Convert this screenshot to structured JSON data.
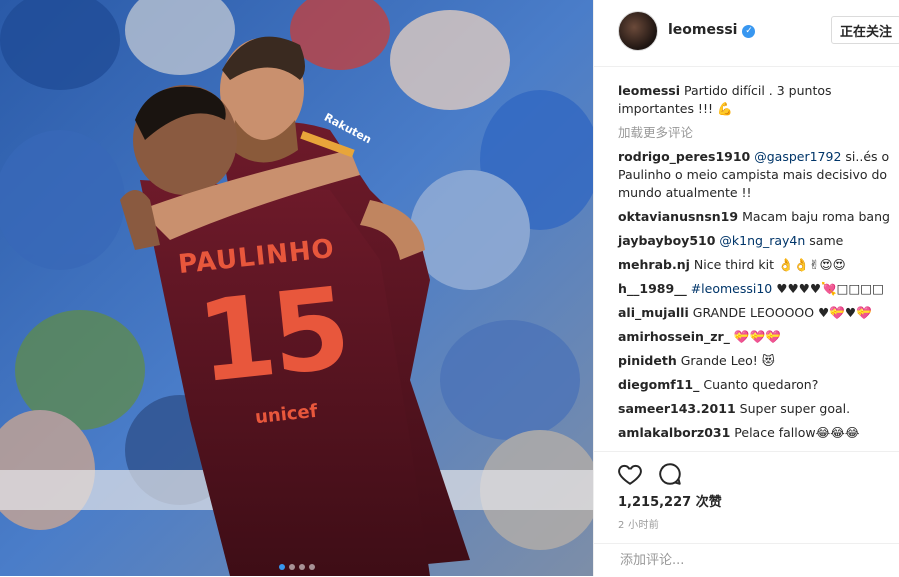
{
  "photo": {
    "jersey_name": "PAULINHO",
    "jersey_number": "15",
    "sponsor": "Rakuten",
    "brand": "unicef",
    "carousel": {
      "count": 4,
      "active": 0
    }
  },
  "header": {
    "username": "leomessi",
    "verified": true,
    "follow_label": "正在关注"
  },
  "caption": {
    "username": "leomessi",
    "text": "Partido difícil . 3 puntos importantes !!! 💪"
  },
  "load_more": "加载更多评论",
  "comments": [
    {
      "username": "rodrigo_peres1910",
      "mention": "@gasper1792",
      "text": "si..és o Paulinho o meio campista mais decisivo do mundo atualmente !!"
    },
    {
      "username": "oktavianusnsn19",
      "mention": "",
      "text": "Macam baju roma bang"
    },
    {
      "username": "jaybayboy510",
      "mention": "@k1ng_ray4n",
      "text": "same"
    },
    {
      "username": "mehrab.nj",
      "mention": "",
      "text": "Nice third kit 👌👌✌😍😍"
    },
    {
      "username": "h__1989__",
      "mention": "#leomessi10",
      "text": "♥♥♥♥💘□□□□"
    },
    {
      "username": "ali_mujalli",
      "mention": "",
      "text": "GRANDE LEOOOOO ♥💝♥💝"
    },
    {
      "username": "amirhossein_zr_",
      "mention": "",
      "text": "💝💝💝"
    },
    {
      "username": "pinideth",
      "mention": "",
      "text": "Grande Leo! 😻"
    },
    {
      "username": "diegomf11_",
      "mention": "",
      "text": "Cuanto quedaron?"
    },
    {
      "username": "sameer143.2011",
      "mention": "",
      "text": "Super super goal."
    },
    {
      "username": "amlakalborz031",
      "mention": "",
      "text": "Pelace fallow😂😂😂"
    }
  ],
  "actions": {
    "like_icon": "heart-icon",
    "comment_icon": "speech-bubble-icon"
  },
  "likes": "1,215,227 次赞",
  "time": "2 小时前",
  "add_comment": {
    "placeholder": "添加评论..."
  },
  "colors": {
    "link": "#003569",
    "verified": "#3897f0",
    "muted": "#999999",
    "shirt": "#5a1420",
    "number": "#e8573c"
  }
}
